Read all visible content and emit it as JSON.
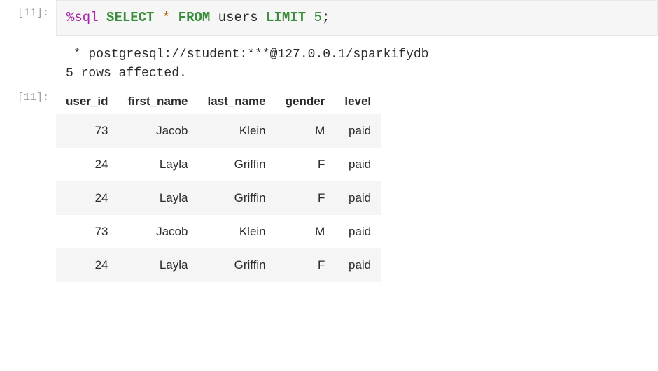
{
  "input_cell": {
    "prompt": "[11]:",
    "magic_prefix": "%",
    "magic_cmd": "sql",
    "query_parts": {
      "select_kw": "SELECT",
      "star": "*",
      "from_kw": "FROM",
      "table": "users",
      "limit_kw": "LIMIT",
      "limit_n": "5",
      "semicolon": ";"
    }
  },
  "stdout": {
    "line1": " * postgresql://student:***@127.0.0.1/sparkifydb",
    "line2": "5 rows affected."
  },
  "output_cell": {
    "prompt": "[11]:",
    "headers": [
      "user_id",
      "first_name",
      "last_name",
      "gender",
      "level"
    ],
    "rows": [
      [
        "73",
        "Jacob",
        "Klein",
        "M",
        "paid"
      ],
      [
        "24",
        "Layla",
        "Griffin",
        "F",
        "paid"
      ],
      [
        "24",
        "Layla",
        "Griffin",
        "F",
        "paid"
      ],
      [
        "73",
        "Jacob",
        "Klein",
        "M",
        "paid"
      ],
      [
        "24",
        "Layla",
        "Griffin",
        "F",
        "paid"
      ]
    ]
  }
}
